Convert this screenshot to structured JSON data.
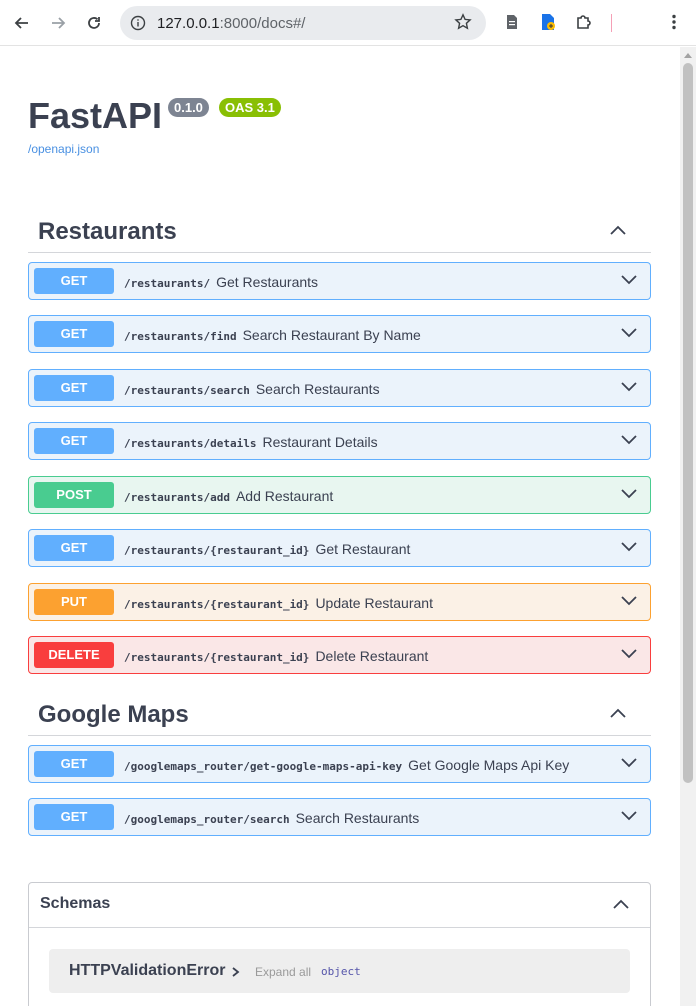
{
  "browser": {
    "url_host": "127.0.0.1",
    "url_rest": ":8000/docs#/"
  },
  "header": {
    "title": "FastAPI",
    "version_badge": "0.1.0",
    "oas_badge": "OAS 3.1",
    "openapi_link": "/openapi.json"
  },
  "tags": [
    {
      "title": "Restaurants"
    },
    {
      "title": "Google Maps"
    }
  ],
  "ops_restaurants": [
    {
      "method": "GET",
      "path": "/restaurants/",
      "summary": "Get Restaurants"
    },
    {
      "method": "GET",
      "path": "/restaurants/find",
      "summary": "Search Restaurant By Name"
    },
    {
      "method": "GET",
      "path": "/restaurants/search",
      "summary": "Search Restaurants"
    },
    {
      "method": "GET",
      "path": "/restaurants/details",
      "summary": "Restaurant Details"
    },
    {
      "method": "POST",
      "path": "/restaurants/add",
      "summary": "Add Restaurant"
    },
    {
      "method": "GET",
      "path": "/restaurants/{restaurant_id}",
      "summary": "Get Restaurant"
    },
    {
      "method": "PUT",
      "path": "/restaurants/{restaurant_id}",
      "summary": "Update Restaurant"
    },
    {
      "method": "DELETE",
      "path": "/restaurants/{restaurant_id}",
      "summary": "Delete Restaurant"
    }
  ],
  "ops_maps": [
    {
      "method": "GET",
      "path": "/googlemaps_router/get-google-maps-api-key",
      "summary": "Get Google Maps Api Key"
    },
    {
      "method": "GET",
      "path": "/googlemaps_router/search",
      "summary": "Search Restaurants"
    }
  ],
  "schemas": {
    "title": "Schemas",
    "model_name": "HTTPValidationError",
    "expand_all": "Expand all",
    "model_type": "object"
  },
  "colors": {
    "get": "#61affe",
    "post": "#49cc90",
    "put": "#fca130",
    "delete": "#f93e3e"
  }
}
